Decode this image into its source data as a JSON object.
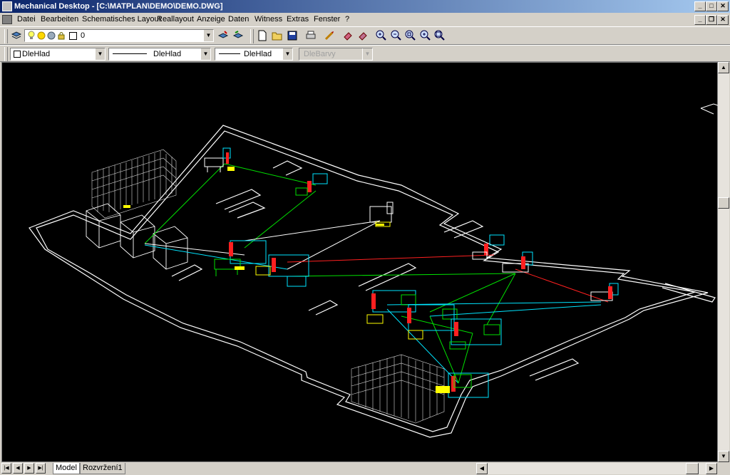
{
  "window": {
    "title": "Mechanical Desktop - [C:\\MATPLAN\\DEMO\\DEMO.DWG]",
    "minimize": "_",
    "maximize": "□",
    "close": "✕",
    "mdi_minimize": "_",
    "mdi_restore": "❐",
    "mdi_close": "✕"
  },
  "menu": {
    "items": [
      "Datei",
      "Bearbeiten",
      "Schematisches Layout",
      "Reallayout",
      "Anzeige",
      "Daten",
      "Witness",
      "Extras",
      "Fenster",
      "?"
    ]
  },
  "layer_toolbar": {
    "layer_name": "0"
  },
  "properties_toolbar": {
    "color": "DleHlad",
    "linetype": "DleHlad",
    "lineweight": "DleHlad",
    "plotstyle": "DleBarvy"
  },
  "tabs": {
    "model": "Model",
    "layout1": "Rozvržení1"
  },
  "colors": {
    "canvas": "#000000",
    "outline": "#ffffff",
    "cyan": "#00e5ff",
    "green": "#00e000",
    "red": "#ff2020",
    "yellow": "#ffff00"
  }
}
